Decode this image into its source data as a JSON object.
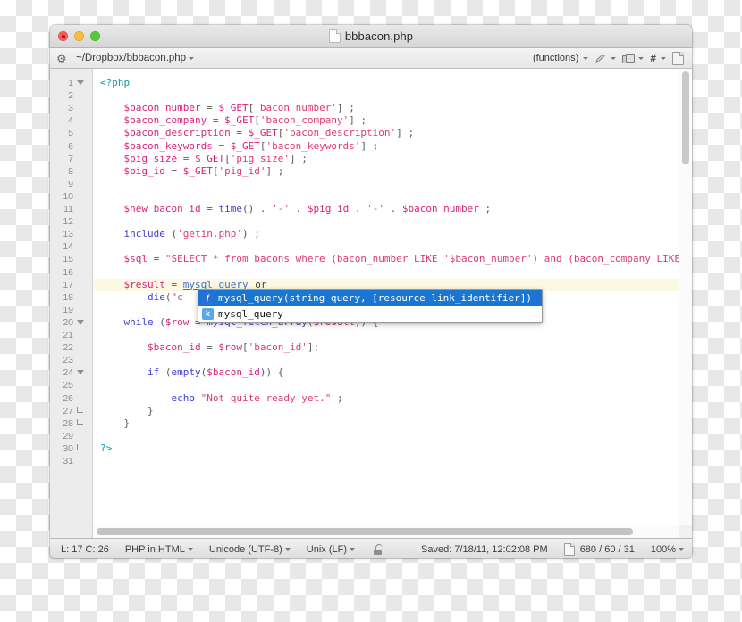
{
  "window": {
    "title": "bbbacon.php",
    "title_icon": "document-icon",
    "traffic_lights": [
      "close-button",
      "minimize-button",
      "maximize-button"
    ]
  },
  "toolbar": {
    "gear_icon": "gear-icon",
    "path": "~/Dropbox/bbbacon.php",
    "functions_menu": "(functions)",
    "pencil_icon": "pencil-icon",
    "panels_icon": "split-panels-icon",
    "hash_icon": "line-numbers-icon",
    "page_icon": "document-icon"
  },
  "editor": {
    "current_line": 17,
    "gutter": [
      {
        "n": "1",
        "mark": "fold-open"
      },
      {
        "n": "2",
        "mark": ""
      },
      {
        "n": "3",
        "mark": ""
      },
      {
        "n": "4",
        "mark": ""
      },
      {
        "n": "5",
        "mark": ""
      },
      {
        "n": "6",
        "mark": ""
      },
      {
        "n": "7",
        "mark": ""
      },
      {
        "n": "8",
        "mark": ""
      },
      {
        "n": "9",
        "mark": ""
      },
      {
        "n": "10",
        "mark": ""
      },
      {
        "n": "11",
        "mark": ""
      },
      {
        "n": "12",
        "mark": ""
      },
      {
        "n": "13",
        "mark": ""
      },
      {
        "n": "14",
        "mark": ""
      },
      {
        "n": "15",
        "mark": ""
      },
      {
        "n": "16",
        "mark": ""
      },
      {
        "n": "17",
        "mark": ""
      },
      {
        "n": "18",
        "mark": ""
      },
      {
        "n": "19",
        "mark": ""
      },
      {
        "n": "20",
        "mark": "fold-open"
      },
      {
        "n": "21",
        "mark": ""
      },
      {
        "n": "22",
        "mark": ""
      },
      {
        "n": "23",
        "mark": ""
      },
      {
        "n": "24",
        "mark": "fold-open"
      },
      {
        "n": "25",
        "mark": ""
      },
      {
        "n": "26",
        "mark": ""
      },
      {
        "n": "27",
        "mark": "fold-end"
      },
      {
        "n": "28",
        "mark": "fold-end"
      },
      {
        "n": "29",
        "mark": ""
      },
      {
        "n": "30",
        "mark": "fold-end"
      },
      {
        "n": "31",
        "mark": ""
      }
    ],
    "lines": [
      "<?php",
      "",
      "    $bacon_number = $_GET['bacon_number'] ;",
      "    $bacon_company = $_GET['bacon_company'] ;",
      "    $bacon_description = $_GET['bacon_description'] ;",
      "    $bacon_keywords = $_GET['bacon_keywords'] ;",
      "    $pig_size = $_GET['pig_size'] ;",
      "    $pig_id = $_GET['pig_id'] ;",
      "",
      "",
      "    $new_bacon_id = time() . '-' . $pig_id . '-' . $bacon_number ;",
      "",
      "    include ('getin.php') ;",
      "",
      "    $sql = \"SELECT * from bacons where (bacon_number LIKE '$bacon_number') and (bacon_company LIKE '$",
      "",
      "    $result = mysql_query or",
      "        die(\"c",
      "",
      "    while ($row = mysql_fetch_array($result)) {",
      "",
      "        $bacon_id = $row['bacon_id'];",
      "",
      "        if (empty($bacon_id)) {",
      "",
      "            echo \"Not quite ready yet.\" ;",
      "        }",
      "    }",
      "",
      "?>",
      ""
    ]
  },
  "autocomplete": {
    "items": [
      {
        "badge": "f",
        "badge_name": "function-icon",
        "label": "mysql_query(string query, [resource link_identifier])",
        "selected": true
      },
      {
        "badge": "k",
        "badge_name": "keyword-icon",
        "label": "mysql_query",
        "selected": false
      }
    ]
  },
  "statusbar": {
    "position": "L: 17 C: 26",
    "language": "PHP in HTML",
    "encoding": "Unicode (UTF-8)",
    "line_endings": "Unix (LF)",
    "lock_icon": "unlocked-icon",
    "saved": "Saved: 7/18/11, 12:02:08 PM",
    "doc_icon": "document-icon",
    "counts": "680 / 60 / 31",
    "zoom": "100%"
  },
  "colors": {
    "accent": "#1a76d2",
    "variable": "#d6247e",
    "keyword": "#3f3fd1",
    "string": "#e03a6e",
    "tag": "#0f9ca1",
    "current_line": "#fbf9e1"
  }
}
